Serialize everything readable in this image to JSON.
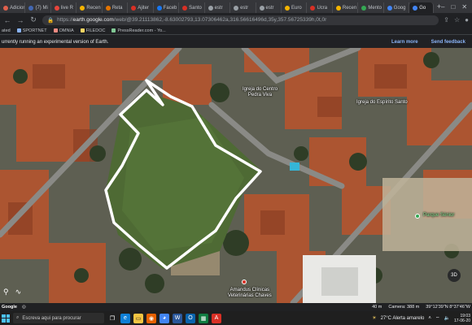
{
  "browser": {
    "tabs": [
      {
        "label": "Adiciona",
        "color": "#e0604c"
      },
      {
        "label": "(7) Mi",
        "color": "#4267b2"
      },
      {
        "label": "live R",
        "color": "#e8453c"
      },
      {
        "label": "Recen",
        "color": "#f4b400"
      },
      {
        "label": "Reta",
        "color": "#e37400"
      },
      {
        "label": "Ajiter",
        "color": "#d93025"
      },
      {
        "label": "Faceb",
        "color": "#1877f2"
      },
      {
        "label": "Santo",
        "color": "#d93025"
      },
      {
        "label": "estr",
        "color": "#9aa0a6"
      },
      {
        "label": "estr",
        "color": "#9aa0a6"
      },
      {
        "label": "estr",
        "color": "#9aa0a6"
      },
      {
        "label": "Euro",
        "color": "#f4b400"
      },
      {
        "label": "Ucra",
        "color": "#d93025"
      },
      {
        "label": "Recen",
        "color": "#f4b400"
      },
      {
        "label": "Mento",
        "color": "#34a853"
      },
      {
        "label": "Goog",
        "color": "#4285f4"
      },
      {
        "label": "Go",
        "color": "#4285f4",
        "active": true
      }
    ],
    "url_prefix": "https://",
    "url_host": "earth.google.com",
    "url_path": "/web/@39.21113862,-8.63002793,13.07306462a,316.56616496d,35y,357.56725339h,0t,0r",
    "bookmarks": [
      "ated",
      "SPORTNET",
      "OMNIA",
      "FILEDOC",
      "PressReader.com - Yo..."
    ]
  },
  "earth": {
    "banner_text": "urrently running an experimental version of Earth.",
    "learn_more": "Learn more",
    "send_feedback": "Send feedback",
    "labels": {
      "church_centro": "Igreja do Centro\nPedra Viva",
      "church_espirito": "Igreja do Espírito Santo",
      "park": "Parque Sénior",
      "clinic": "Amandus Clínicas\nVeterinárias Chaves"
    },
    "status": {
      "google": "Google",
      "scale": "40 m",
      "camera": "Camera: 388 m",
      "coords": "39°12'39\"N 8°37'46\"W"
    }
  },
  "taskbar": {
    "search_placeholder": "Escreva aqui para procurar",
    "weather": "27°C  Alerta amarelo",
    "time": "19:03",
    "date": "17-06-20"
  }
}
